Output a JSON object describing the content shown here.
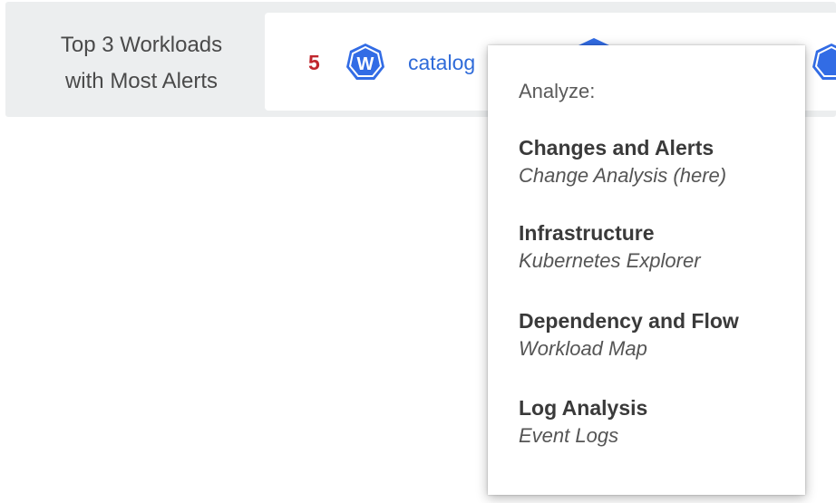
{
  "strip": {
    "label_line1": "Top 3 Workloads",
    "label_line2": "with Most Alerts"
  },
  "workloads": [
    {
      "count": "5",
      "icon": "kubernetes-workload-icon",
      "icon_letter": "W",
      "name": "catalog"
    }
  ],
  "colors": {
    "alert_count": "#c0262d",
    "link": "#2f6bd9",
    "icon_blue": "#326ce5"
  },
  "menu": {
    "header": "Analyze:",
    "items": [
      {
        "title": "Changes and Alerts",
        "subtitle": "Change Analysis (here)"
      },
      {
        "title": "Infrastructure",
        "subtitle": "Kubernetes Explorer"
      },
      {
        "title": "Dependency and Flow",
        "subtitle": "Workload Map"
      },
      {
        "title": "Log Analysis",
        "subtitle": "Event Logs"
      }
    ]
  }
}
